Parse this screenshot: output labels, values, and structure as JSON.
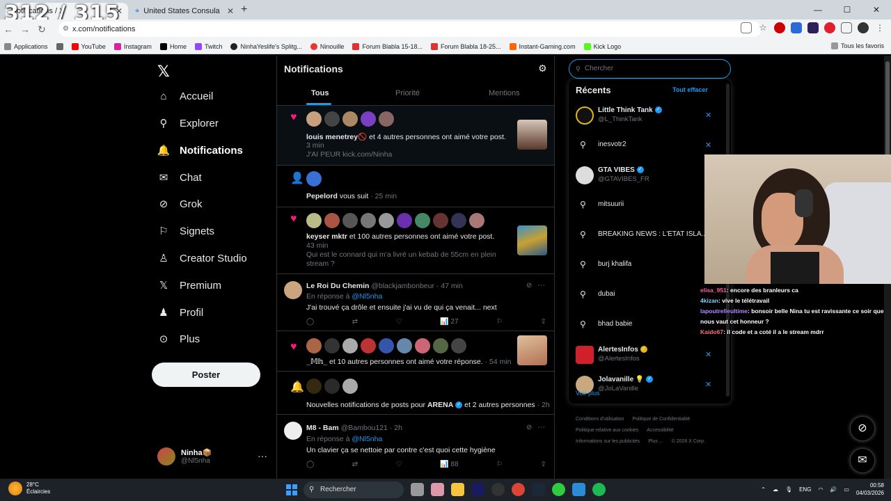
{
  "browser": {
    "overlay_counter": "312 / 315",
    "active_tab": "Notifications / X",
    "tab2": "United States Consulate Dubai",
    "url": "x.com/notifications",
    "bookmarks": [
      "Applications",
      "YouTube",
      "Instagram",
      "Home",
      "Twitch",
      "NinhaYeslife's Splitg...",
      "Ninouille",
      "Forum Blabla 15-18...",
      "Forum Blabla 18-25...",
      "Instant-Gaming.com",
      "Kick Logo"
    ],
    "all_bookmarks": "Tous les favoris"
  },
  "nav": {
    "items": [
      {
        "label": "Accueil",
        "icon": "home-icon"
      },
      {
        "label": "Explorer",
        "icon": "search-icon"
      },
      {
        "label": "Notifications",
        "icon": "bell-icon"
      },
      {
        "label": "Chat",
        "icon": "mail-icon"
      },
      {
        "label": "Grok",
        "icon": "grok-icon"
      },
      {
        "label": "Signets",
        "icon": "bookmark-icon"
      },
      {
        "label": "Creator Studio",
        "icon": "creator-icon"
      },
      {
        "label": "Premium",
        "icon": "x-icon"
      },
      {
        "label": "Profil",
        "icon": "user-icon"
      },
      {
        "label": "Plus",
        "icon": "more-icon"
      }
    ],
    "post_button": "Poster",
    "profile_name": "Ninha📦",
    "profile_handle": "@Nl5nha"
  },
  "main": {
    "title": "Notifications",
    "tabs": [
      "Tous",
      "Priorité",
      "Mentions"
    ],
    "notifs": [
      {
        "user": "louis menetrey🚫",
        "text": " et 4 autres personnes ont aimé votre post.",
        "time": "3 min",
        "quote": "J'AI PEUR kick.com/Ninha"
      },
      {
        "user": "Pepelord",
        "text": " vous suit",
        "time": "· 25 min"
      },
      {
        "user": "keyser mktr",
        "text": " et 100 autres personnes ont aimé votre post.",
        "time": "43 min",
        "quote": "Qui est le connard qui m'a livré un kebab de 55cm en plein",
        "quote2": "stream ?"
      },
      {
        "user": "Le Roi Du Chemin",
        "handle": "@blackjambonbeur · 47 min",
        "reply": "En réponse à",
        "reply_to": "@Nl5nha",
        "body": "J'ai trouvé ça drôle et ensuite j'ai vu de qui ça venait... next",
        "views": "27"
      },
      {
        "user": "_𝕄𝕙_",
        "text": " et 10 autres personnes ont aimé votre réponse.",
        "time": "· 54 min"
      },
      {
        "text": "Nouvelles notifications de posts pour ",
        "user": "ARENA",
        "text2": " et 2 autres personnes",
        "time": "· 2h"
      },
      {
        "user": "M8 - Bam",
        "handle": "@Bambou121 · 2h",
        "reply": "En réponse à",
        "reply_to": "@Nl5nha",
        "body": "Un clavier ça se nettoie par contre c'est quoi cette hygiène",
        "views": "88"
      }
    ]
  },
  "search": {
    "placeholder": "Chercher",
    "recents_title": "Récents",
    "clear_all": "Tout effacer",
    "items": [
      {
        "type": "user",
        "name": "Little Think Tank",
        "handle": "@L_ThinkTank"
      },
      {
        "type": "query",
        "text": "inesvotr2"
      },
      {
        "type": "user",
        "name": "GTA VIBES",
        "handle": "@GTAVIBES_FR"
      },
      {
        "type": "query",
        "text": "mitsuurii"
      },
      {
        "type": "query",
        "text": "BREAKING NEWS : L'ÉTAT ISLA..."
      },
      {
        "type": "query",
        "text": "burj khalifa"
      },
      {
        "type": "query",
        "text": "dubai"
      },
      {
        "type": "query",
        "text": "bhad babie"
      },
      {
        "type": "user",
        "name": "AlertesInfos",
        "handle": "@AlertesInfos"
      },
      {
        "type": "user",
        "name": "Jolavanille 💡",
        "handle": "@JoLaVanille"
      }
    ],
    "see_more": "Voir plus"
  },
  "footer": [
    "Conditions d'utilisation",
    "Politique de Confidentialité",
    "Politique relative aux cookies",
    "Accessibilité",
    "Informations sur les publicités",
    "Plus ...",
    "© 2026 X Corp."
  ],
  "chat": [
    {
      "user": "elisa_951",
      "msg": ": encore des branleurs ca"
    },
    {
      "user": "4kizan",
      "msg": ": vive le télétravail"
    },
    {
      "user": "lapoutrelleultime",
      "msg": ": bonsoir belle Nina tu est ravissante ce soir que nous vaut cet honneur ?"
    },
    {
      "user": "Kaido67",
      "msg": ": il code et a coté il a le stream mdrr"
    }
  ],
  "taskbar": {
    "temp": "28°C",
    "weather": "Éclaircies",
    "search": "Rechercher",
    "lang": "ENG",
    "time": "00:58",
    "date": "04/03/2026"
  }
}
